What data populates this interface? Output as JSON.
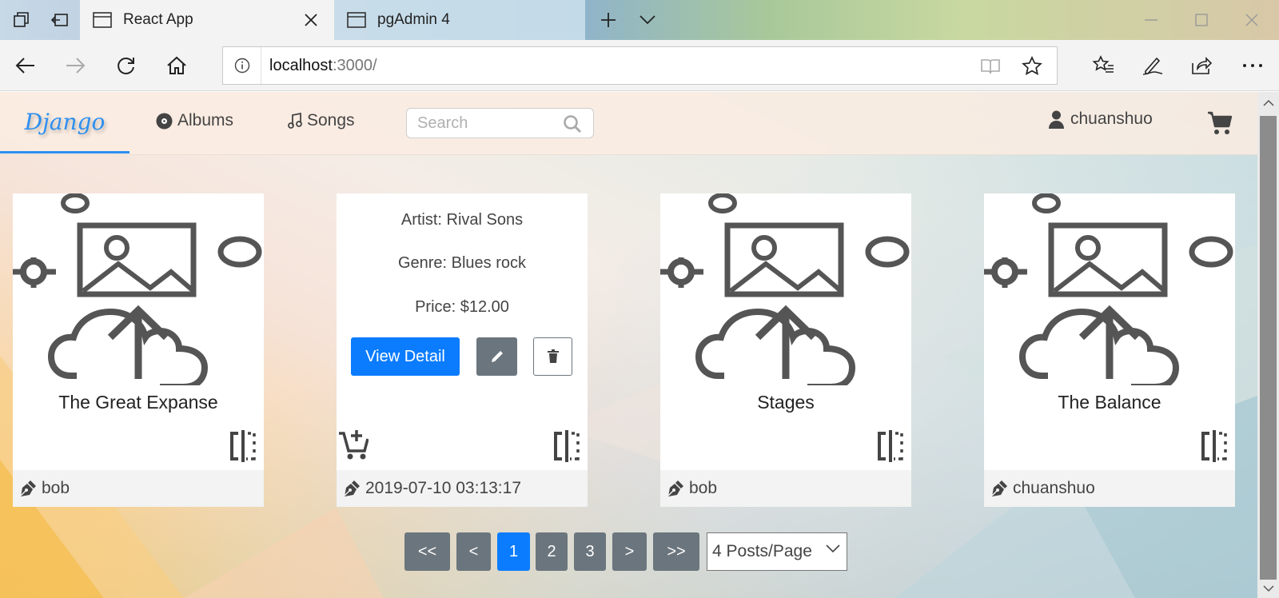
{
  "browser": {
    "tabs": [
      {
        "label": "React App",
        "active": true
      },
      {
        "label": "pgAdmin 4",
        "active": false
      }
    ],
    "address": {
      "host": "localhost",
      "path": ":3000/"
    }
  },
  "app": {
    "brand": "Django",
    "nav": [
      {
        "label": "Albums",
        "icon": "disc-icon"
      },
      {
        "label": "Songs",
        "icon": "music-note-icon"
      }
    ],
    "search": {
      "placeholder": "Search",
      "value": ""
    },
    "user": "chuanshuo"
  },
  "cards": [
    {
      "title": "The Great Expanse",
      "footer": "bob"
    },
    {
      "artist": "Artist: Rival Sons",
      "genre": "Genre: Blues rock",
      "price": "Price: $12.00",
      "view_label": "View Detail",
      "footer": "2019-07-10 03:13:17"
    },
    {
      "title": "Stages",
      "footer": "bob"
    },
    {
      "title": "The Balance",
      "footer": "chuanshuo"
    }
  ],
  "pagination": {
    "first": "<<",
    "prev": "<",
    "pages": [
      "1",
      "2",
      "3"
    ],
    "current": "1",
    "next": ">",
    "last": ">>",
    "per_page": "4 Posts/Page"
  },
  "colors": {
    "primary": "#0b7cfe",
    "secondary": "#6b757d",
    "brand": "#2d8ff0"
  }
}
